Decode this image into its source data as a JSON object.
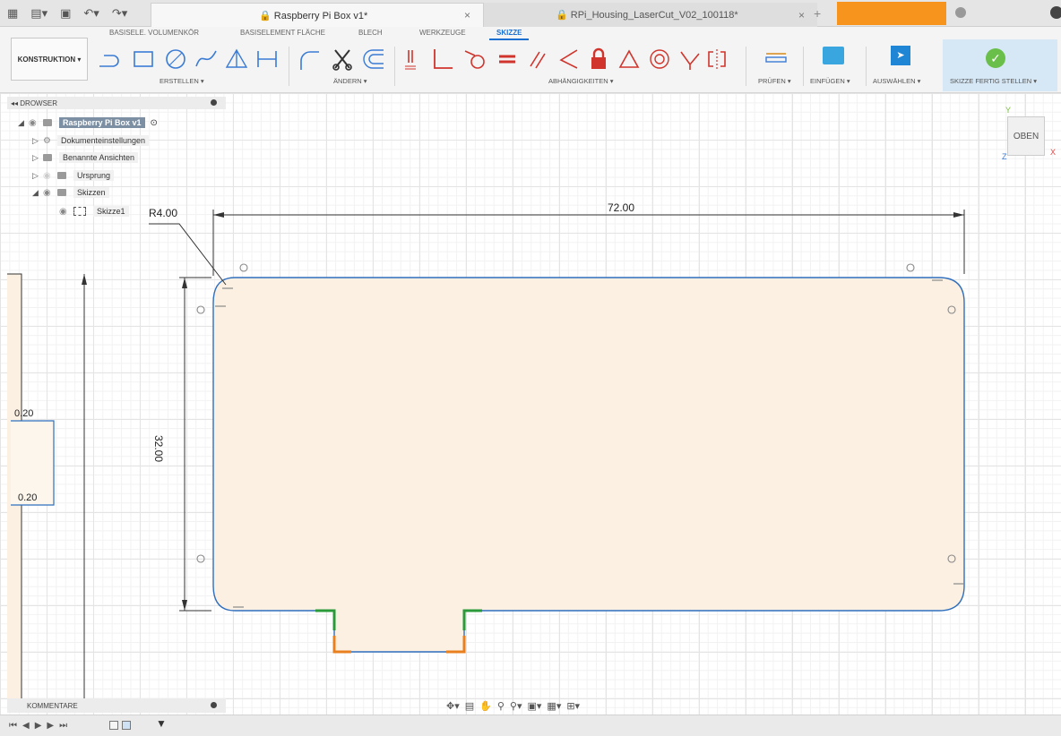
{
  "tabs": [
    {
      "label": "Raspberry Pi Box v1*",
      "active": true,
      "close": "×"
    },
    {
      "label": "RPi_Housing_LaserCut_V02_100118*",
      "active": false,
      "close": "×"
    }
  ],
  "new_tab": "+",
  "ribbon": {
    "workspace": "KONSTRUKTION ▾",
    "tabs": [
      "BASISELE. VOLUMENKÖR",
      "BASISELEMENT FLÄCHE",
      "BLECH",
      "WERKZEUGE",
      "SKIZZE"
    ],
    "active_tab": "SKIZZE",
    "groups": {
      "create": "ERSTELLEN ▾",
      "modify": "ÄNDERN ▾",
      "constraints": "ABHÄNGIGKEITEN ▾",
      "inspect": "PRÜFEN ▾",
      "insert": "EINFÜGEN ▾",
      "select": "AUSWÄHLEN ▾",
      "finish": "SKIZZE FERTIG STELLEN ▾"
    }
  },
  "browser": {
    "title": "DROWSER",
    "root": "Raspberry Pi Box v1",
    "items": [
      {
        "label": "Dokumenteinstellungen",
        "icon": "gear-icon"
      },
      {
        "label": "Benannte Ansichten",
        "icon": "folder-icon"
      },
      {
        "label": "Ursprung",
        "icon": "folder-icon"
      },
      {
        "label": "Skizzen",
        "icon": "folder-icon"
      },
      {
        "label": "Skizze1",
        "icon": "sketch-icon"
      }
    ]
  },
  "comments": {
    "label": "KOMMENTARE"
  },
  "viewcube": {
    "face": "OBEN",
    "axes": {
      "x": "X",
      "y": "Y",
      "z": "Z"
    }
  },
  "sketch": {
    "dim_width": "72.00",
    "dim_height": "32.00",
    "dim_radius": "R4.00",
    "dim_left_top": "0.20",
    "dim_left_bottom": "0.20"
  },
  "colors": {
    "accent": "#1a6fd1",
    "profile_fill": "#fbf0e2",
    "sketch_line": "#2f6fbe",
    "constraint_green": "#2a9a3a",
    "constraint_orange": "#e8801f",
    "finish_check": "#6abf4b",
    "orange_tab": "#f7941d"
  }
}
